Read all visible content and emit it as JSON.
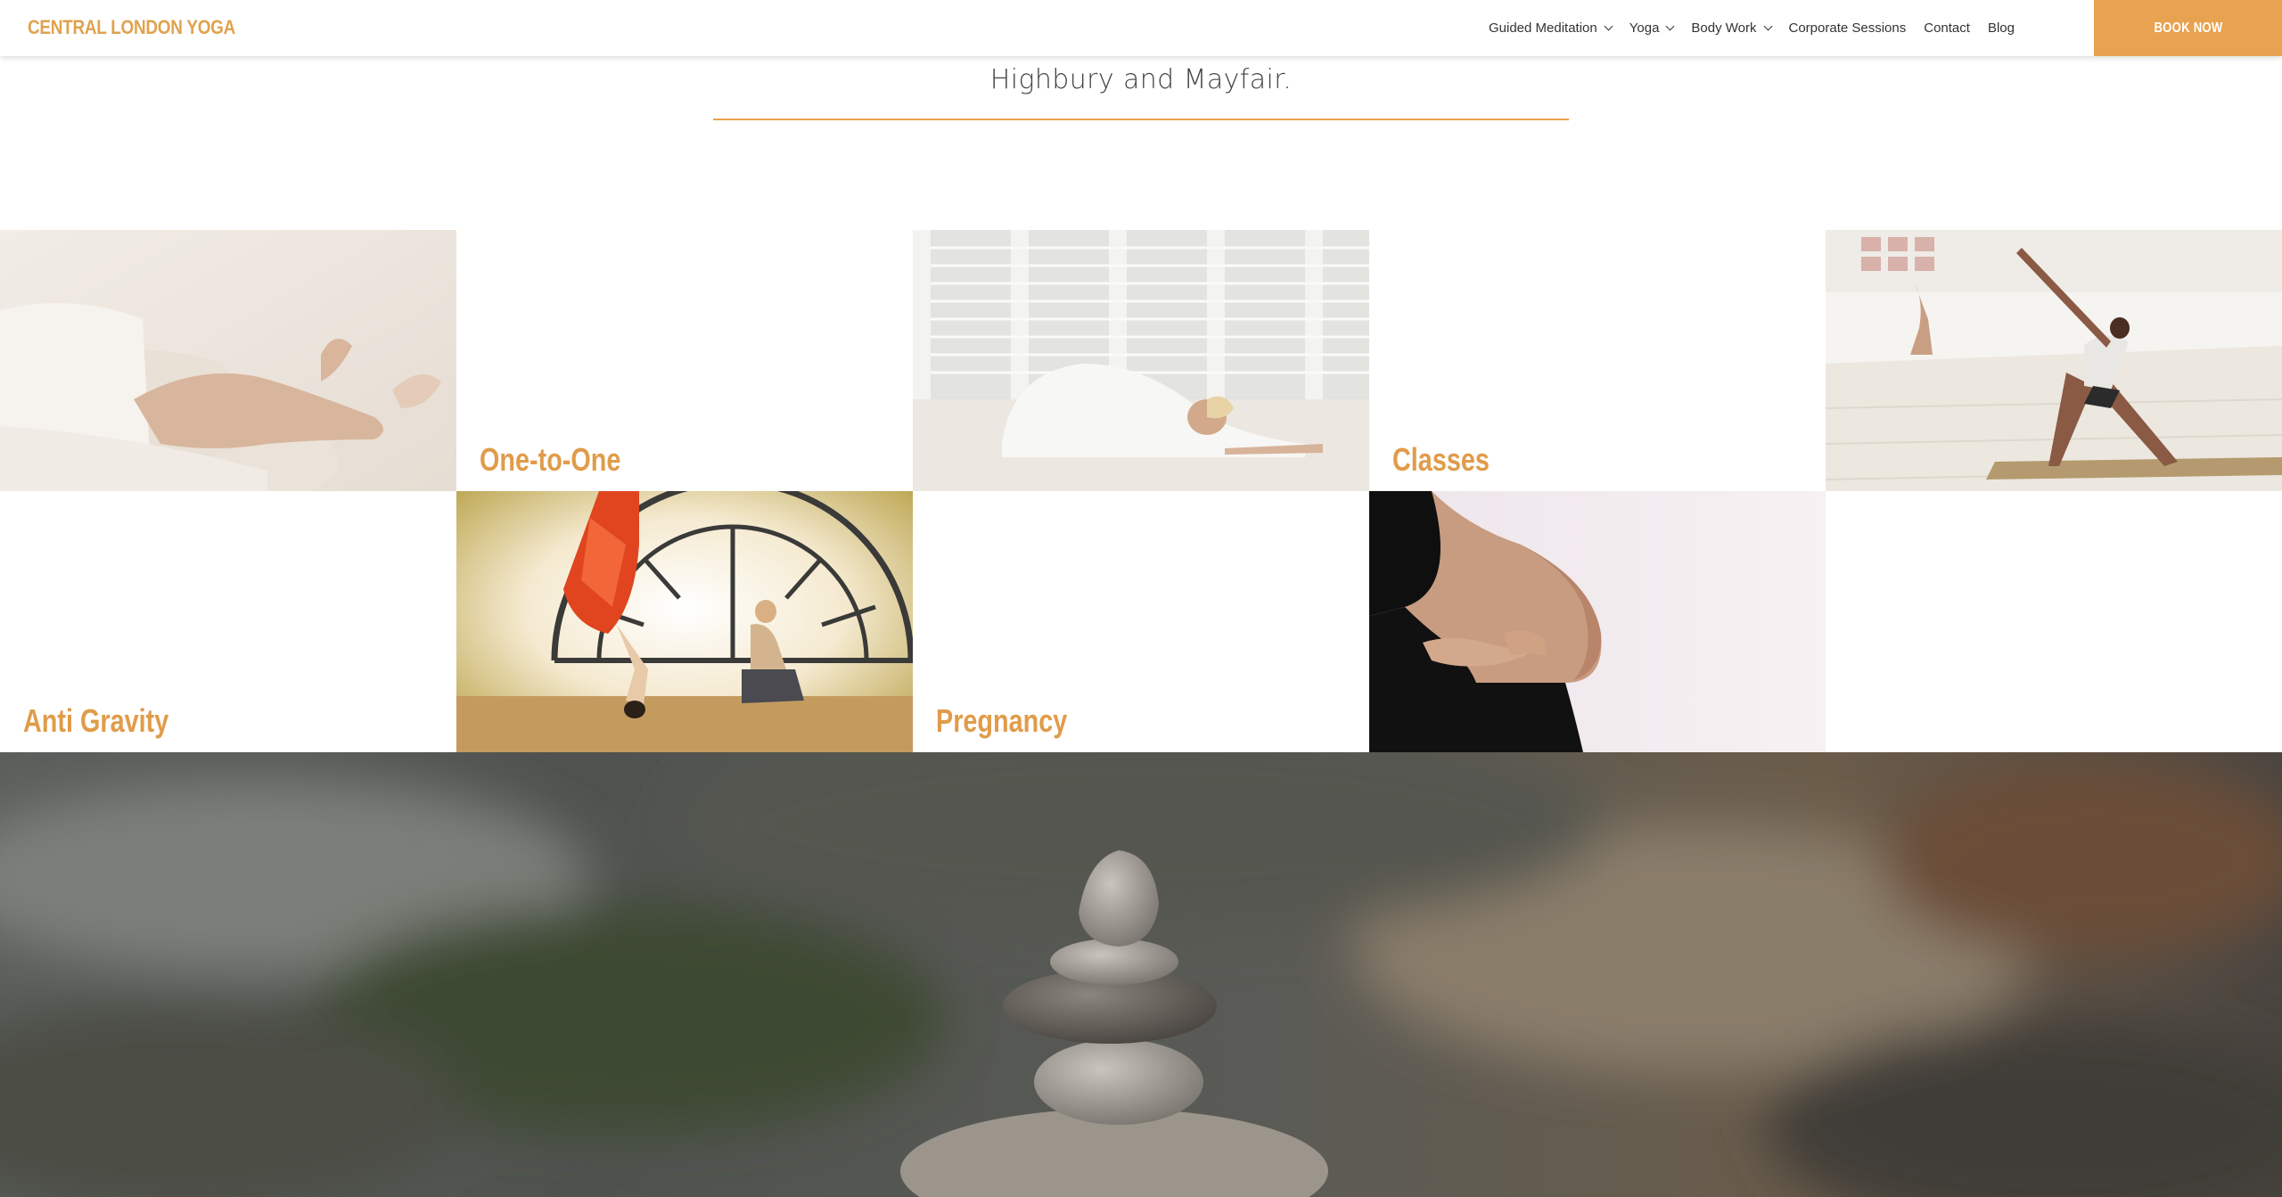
{
  "header": {
    "logo": "CENTRAL LONDON YOGA",
    "nav": [
      {
        "label": "Guided Meditation",
        "has_dropdown": true
      },
      {
        "label": "Yoga",
        "has_dropdown": true
      },
      {
        "label": "Body Work",
        "has_dropdown": true
      },
      {
        "label": "Corporate Sessions",
        "has_dropdown": false
      },
      {
        "label": "Contact",
        "has_dropdown": false
      },
      {
        "label": "Blog",
        "has_dropdown": false
      }
    ],
    "book_label": "BOOK NOW"
  },
  "intro": {
    "text": "Highbury and Mayfair."
  },
  "grid": {
    "labels": {
      "one_to_one": "One-to-One",
      "classes": "Classes",
      "anti_gravity": "Anti Gravity",
      "pregnancy": "Pregnancy"
    }
  },
  "colors": {
    "accent": "#e9a24f",
    "label": "#e09c4a",
    "text": "#333333"
  }
}
